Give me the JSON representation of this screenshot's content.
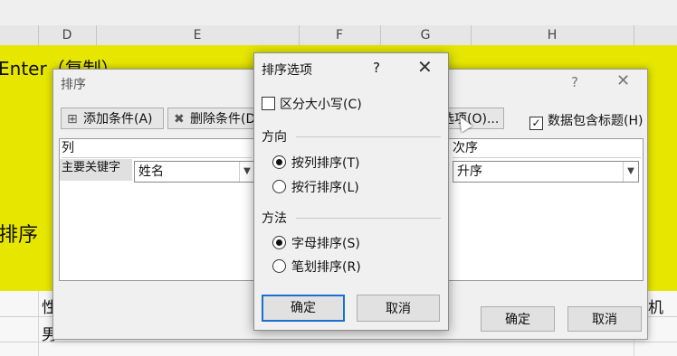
{
  "sheet": {
    "columns": [
      "D",
      "E",
      "F",
      "G",
      "H"
    ],
    "text_enter": "Enter（复制）",
    "text_sort": "排序",
    "partial_header": "性",
    "partial_right": "机",
    "partial_cell": "男"
  },
  "sort_dialog": {
    "title": "排序",
    "help": "?",
    "close": "✕",
    "add_condition": "添加条件(A)",
    "delete_condition": "删除条件(D)",
    "options_btn": "选项(O)...",
    "header_checkbox": "数据包含标题(H)",
    "header_checked": true,
    "col_header": "列",
    "order_header": "次序",
    "primary_key_label": "主要关键字",
    "primary_key_value": "姓名",
    "order_value": "升序",
    "ok": "确定",
    "cancel": "取消"
  },
  "options_dialog": {
    "title": "排序选项",
    "help": "?",
    "close": "✕",
    "case_sensitive": "区分大小写(C)",
    "case_checked": false,
    "orientation_label": "方向",
    "by_column": "按列排序(T)",
    "by_row": "按行排序(L)",
    "method_label": "方法",
    "by_letter": "字母排序(S)",
    "by_stroke": "笔划排序(R)",
    "ok": "确定",
    "cancel": "取消"
  },
  "colors": {
    "highlight_yellow": "#e6e600",
    "default_button_border": "#1a6fd1"
  }
}
